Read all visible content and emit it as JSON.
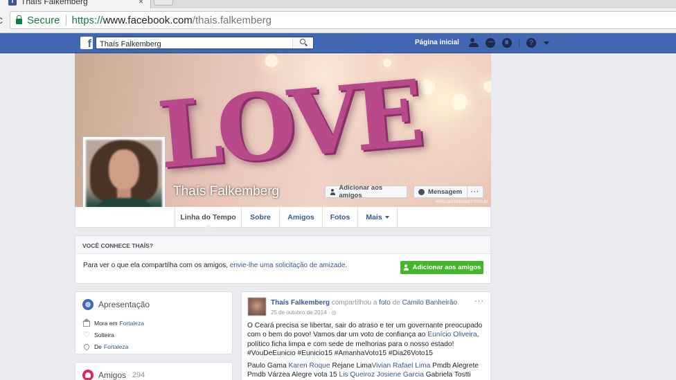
{
  "browser": {
    "tab_title": "Thaís Falkemberg",
    "tab_close": "×",
    "secure_label": "Secure",
    "url_scheme": "https://",
    "url_host": "www.facebook.com",
    "url_path": "/thais.falkemberg",
    "reload_glyph": "c"
  },
  "topbar": {
    "logo": "f",
    "search_value": "Thaís Falkemberg",
    "home_link": "Página inicial",
    "help_glyph": "?"
  },
  "cover": {
    "decor_text": "LOVE",
    "name": "Thaís Falkemberg",
    "add_friend": "Adicionar aos amigos",
    "message": "Mensagem",
    "more": "···",
    "watermark": "www.portalpower.com.br"
  },
  "tabs": [
    {
      "label": "Linha do Tempo"
    },
    {
      "label": "Sobre"
    },
    {
      "label": "Amigos"
    },
    {
      "label": "Fotos"
    },
    {
      "label": "Mais"
    }
  ],
  "know_box": {
    "heading": "VOCÊ CONHECE THAÍS?",
    "text_prefix": "Para ver o que ela compartilha com os amigos, ",
    "text_link": "envie-lhe uma solicitação de amizade",
    "text_suffix": ".",
    "button": "Adicionar aos amigos"
  },
  "intro": {
    "heading": "Apresentação",
    "lives_label": "Mora em",
    "lives_value": "Fortaleza",
    "relationship": "Solteira",
    "from_label": "De",
    "from_value": "Fortaleza"
  },
  "friends": {
    "heading": "Amigos",
    "separator": " · ",
    "count": "294"
  },
  "post": {
    "author": "Thaís Falkemberg",
    "action": " compartilhou a ",
    "object": "foto",
    "of": " de ",
    "source": "Camilo Banheirão",
    "end": ".",
    "date": "25 de outubro de 2014 · ",
    "privacy_glyph": "◎",
    "more": "···",
    "body_1": "O Ceará precisa se libertar, sair do atraso e ter um governante preocupado com o bem do povo! Vamos dar um voto de confiança ao ",
    "body_link": "Eunício Oliveira",
    "body_2": ", político ficha limpa e com sede de melhorias para o nosso estado! #VouDeEunicio #Eunicio15 #AmanhaVoto15 #Dia26Voto15",
    "tags_1": "Paulo Gama ",
    "tags_link_1": "Karen Roque",
    "tags_2": " Rejane Lima",
    "tags_link_2": "Vivian Rafael Lima",
    "tags_3": " Pmdb Alegrete Pmdb Várzea Alegre vota 15 ",
    "tags_link_3": "Lis Queiroz",
    "tags_4": " ",
    "tags_link_4": "Josiene Garcia",
    "tags_5": " Gabriela Tostti"
  }
}
